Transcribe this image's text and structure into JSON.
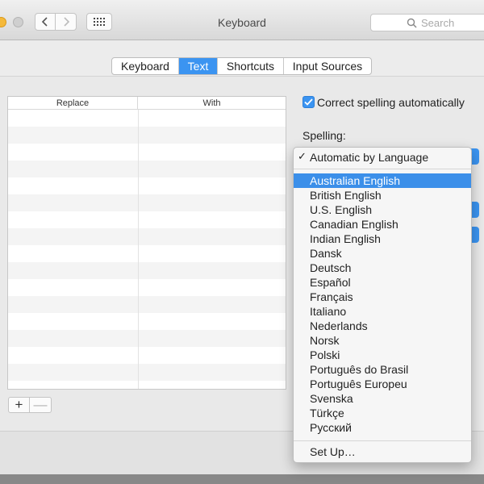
{
  "window": {
    "title": "Keyboard"
  },
  "search": {
    "placeholder": "Search"
  },
  "tabs": [
    {
      "label": "Keyboard",
      "active": false
    },
    {
      "label": "Text",
      "active": true
    },
    {
      "label": "Shortcuts",
      "active": false
    },
    {
      "label": "Input Sources",
      "active": false
    }
  ],
  "table": {
    "headers": {
      "replace": "Replace",
      "with": "With"
    },
    "rows": []
  },
  "buttons": {
    "add": "+",
    "remove": "—"
  },
  "options": {
    "correct_spelling_label": "Correct spelling automatically",
    "correct_spelling_checked": true,
    "spelling_label": "Spelling:"
  },
  "spelling_menu": {
    "checked_item": "Automatic by Language",
    "items": [
      "Australian English",
      "British English",
      "U.S. English",
      "Canadian English",
      "Indian English",
      "Dansk",
      "Deutsch",
      "Español",
      "Français",
      "Italiano",
      "Nederlands",
      "Norsk",
      "Polski",
      "Português do Brasil",
      "Português Europeu",
      "Svenska",
      "Türkçe",
      "Русский"
    ],
    "highlighted_item": "Australian English",
    "setup_item": "Set Up…"
  },
  "colors": {
    "accent": "#3b94f1",
    "menu_highlight": "#3b8fe9"
  }
}
